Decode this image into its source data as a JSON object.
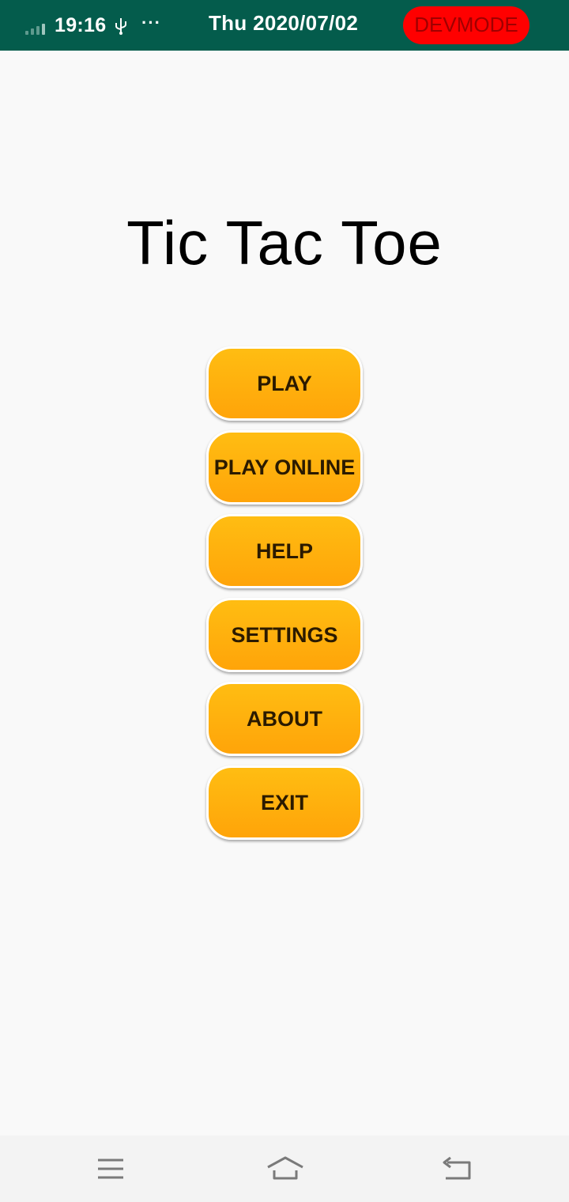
{
  "status_bar": {
    "time": "19:16",
    "date": "Thu 2020/07/02",
    "devmode_label": "DEVMODE",
    "icons": [
      "signal-icon",
      "usb-icon",
      "more-icon"
    ],
    "background_color": "#045c4c",
    "devmode_color": "#ff0000"
  },
  "app": {
    "title": "Tic Tac Toe"
  },
  "menu": {
    "play": "PLAY",
    "play_online": "PLAY ONLINE",
    "help": "HELP",
    "settings": "SETTINGS",
    "about": "ABOUT",
    "exit": "EXIT",
    "button_color": "#ffb00e"
  },
  "nav_bar": {
    "icons": [
      "menu-icon",
      "home-icon",
      "back-icon"
    ]
  }
}
